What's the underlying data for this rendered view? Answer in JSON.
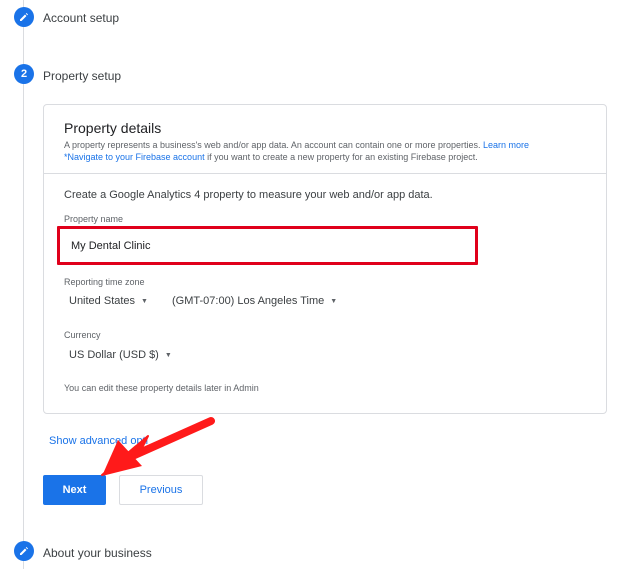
{
  "steps": {
    "account": "Account setup",
    "property_number": "2",
    "property": "Property setup",
    "business": "About your business"
  },
  "card": {
    "title": "Property details",
    "subtitle_text": "A property represents a business's web and/or app data. An account can contain one or more properties.",
    "learn_more": "Learn more",
    "firebase_link": "*Navigate to your Firebase account",
    "firebase_text": "if you want to create a new property for an existing Firebase project.",
    "intro": "Create a Google Analytics 4 property to measure your web and/or app data.",
    "property_name_label": "Property name",
    "property_name_value": "My Dental Clinic",
    "timezone_label": "Reporting time zone",
    "country": "United States",
    "timezone": "(GMT-07:00) Los Angeles Time",
    "currency_label": "Currency",
    "currency": "US Dollar (USD $)",
    "note": "You can edit these property details later in Admin"
  },
  "advanced": "Show advanced opti",
  "buttons": {
    "next": "Next",
    "previous": "Previous"
  },
  "colors": {
    "accent": "#1a73e8",
    "highlight": "#e0001b"
  }
}
